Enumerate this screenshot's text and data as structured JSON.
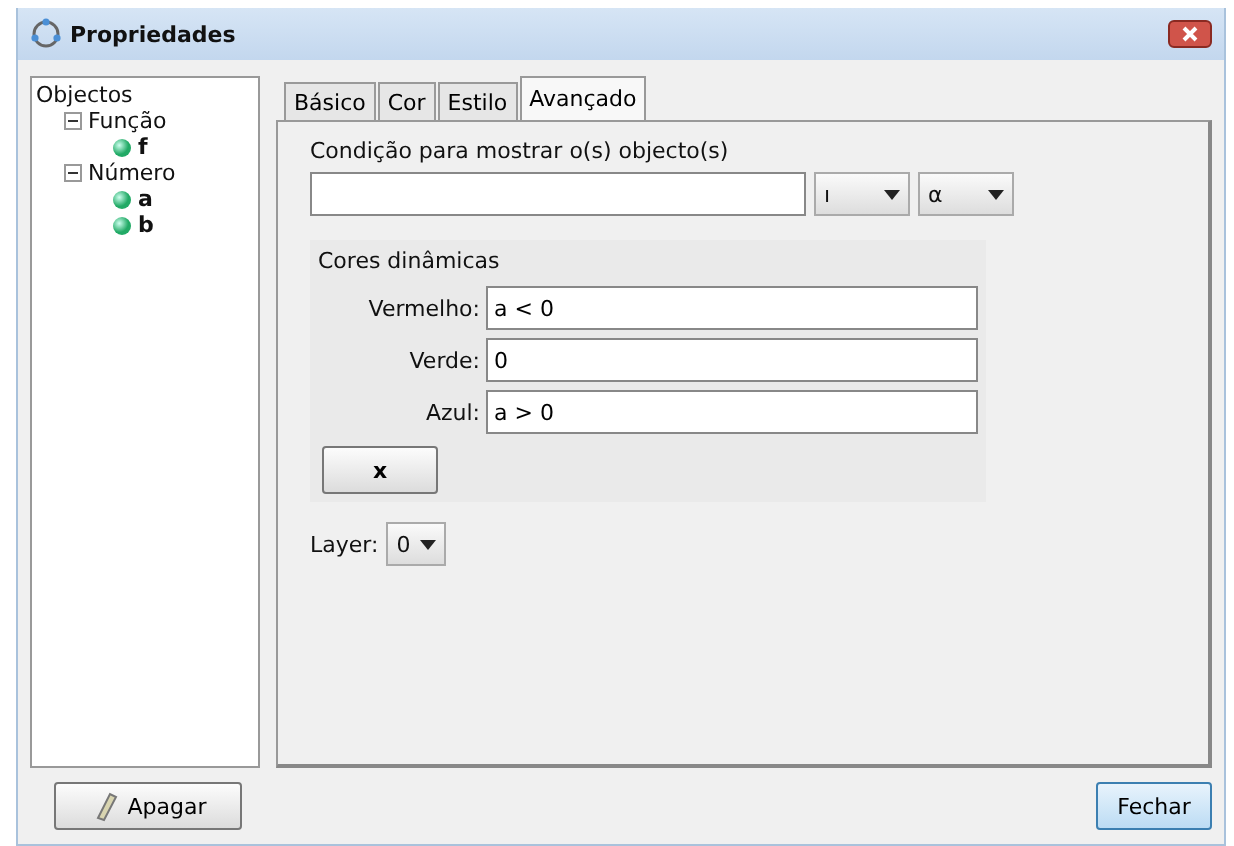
{
  "window": {
    "title": "Propriedades"
  },
  "tree": {
    "label": "Objectos",
    "children": [
      {
        "label": "Função",
        "expanded": true,
        "children": [
          {
            "label": "f"
          }
        ]
      },
      {
        "label": "Número",
        "expanded": true,
        "children": [
          {
            "label": "a"
          },
          {
            "label": "b"
          }
        ]
      }
    ]
  },
  "tabs": [
    {
      "label": "Básico",
      "selected": false
    },
    {
      "label": "Cor",
      "selected": false
    },
    {
      "label": "Estilo",
      "selected": false
    },
    {
      "label": "Avançado",
      "selected": true
    }
  ],
  "condition": {
    "label": "Condição para mostrar o(s) objecto(s)",
    "symbol_combo": "ı",
    "greek_combo": "α"
  },
  "dynamic_colors": {
    "title": "Cores dinâmicas",
    "fields": [
      {
        "label": "Vermelho:",
        "value": "a < 0"
      },
      {
        "label": "Verde:",
        "value": "0"
      },
      {
        "label": "Azul:",
        "value": "a > 0"
      }
    ],
    "clear_button": "x"
  },
  "layer": {
    "label": "Layer:",
    "value": "0"
  },
  "buttons": {
    "delete": "Apagar",
    "close": "Fechar"
  }
}
